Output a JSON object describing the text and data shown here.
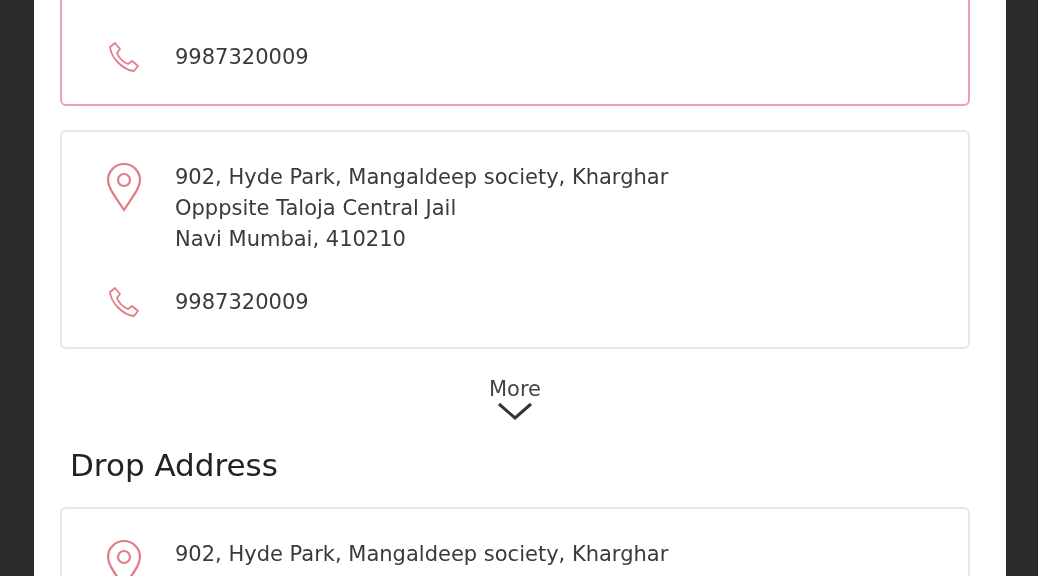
{
  "pickup_addresses": [
    {
      "selected": true,
      "phone": "9987320009"
    },
    {
      "selected": false,
      "address_lines": [
        "902, Hyde Park, Mangaldeep society, Kharghar",
        "Opppsite Taloja Central Jail",
        "Navi Mumbai, 410210"
      ],
      "phone": "9987320009"
    }
  ],
  "more": {
    "label": "More"
  },
  "drop_address": {
    "title": "Drop Address",
    "cards": [
      {
        "selected": false,
        "address_lines": [
          "902, Hyde Park, Mangaldeep society, Kharghar"
        ]
      }
    ]
  }
}
